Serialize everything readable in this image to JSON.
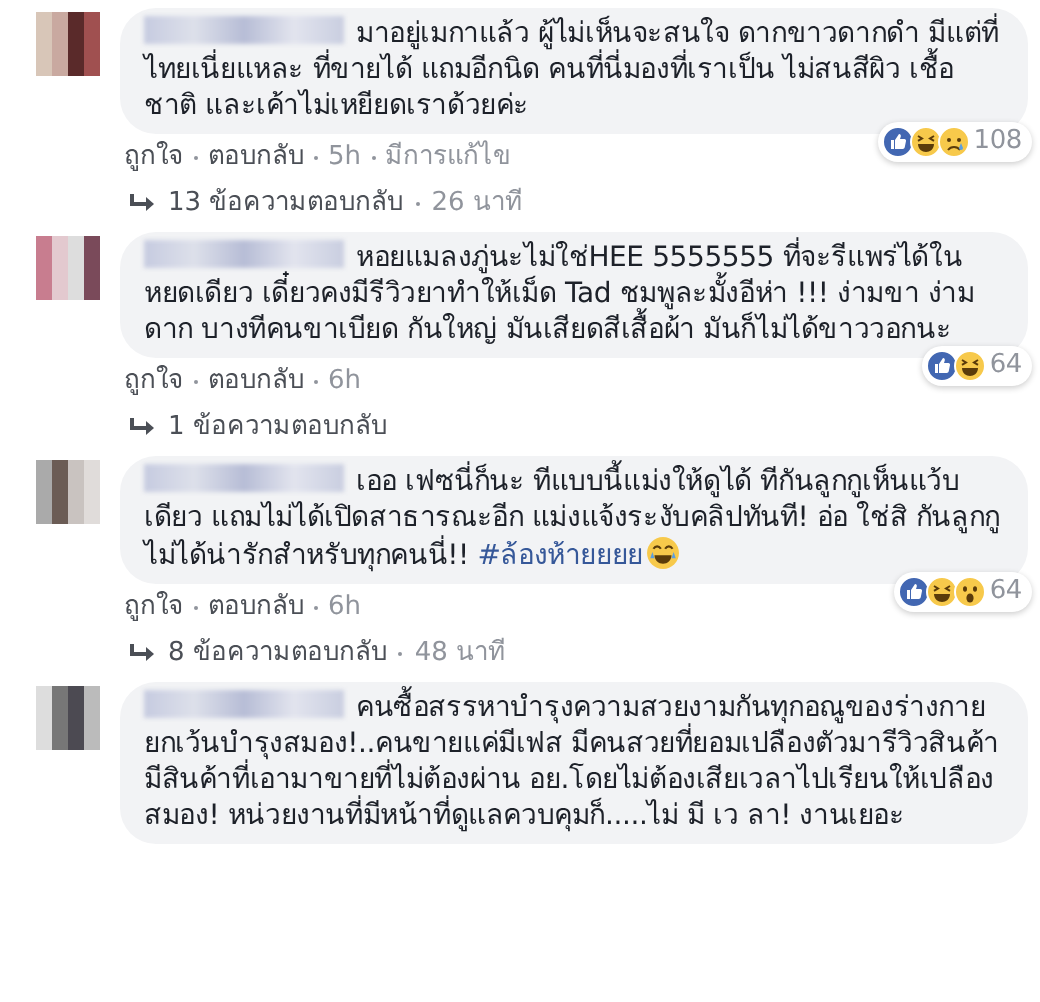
{
  "comments": [
    {
      "segments": [
        {
          "kind": "text",
          "text": "มาอยู่เมกาแล้ว ผู้ไม่เห็นจะสนใจ ดากขาวดากดำ มีแต่ที่ไทยเนี่ยแหละ ที่ขายได้ แถมอีกนิด คนที่นี่มองที่เราเป็น ไม่สนสีผิว เชื้อชาติ และเค้าไม่เหยียดเราด้วยค่ะ"
        }
      ],
      "reactions": [
        {
          "kind": "like"
        },
        {
          "kind": "haha"
        },
        {
          "kind": "sad"
        }
      ],
      "reaction_count": "108",
      "actions": [
        "ถูกใจ",
        "ตอบกลับ",
        "5h",
        "มีการแก้ไข"
      ],
      "replies": {
        "label": "13 ข้อความตอบกลับ",
        "time": "26 นาที"
      }
    },
    {
      "segments": [
        {
          "kind": "text",
          "text": "หอยแมลงภู่นะไม่ใช่HEE 5555555 ที่จะรีแพร่ได้ในหยดเดียว เดี๋ยวคงมีรีวิวยาทำให้เม็ด Tad ชมพูละมั้งอีห่า !!! ง่ามขา ง่ามดาก บางทีคนขาเบียด กันใหญ่ มันเสียดสีเสื้อผ้า มันก็ไม่ได้ขาววอกนะ"
        }
      ],
      "reactions": [
        {
          "kind": "like"
        },
        {
          "kind": "haha"
        }
      ],
      "reaction_count": "64",
      "actions": [
        "ถูกใจ",
        "ตอบกลับ",
        "6h"
      ],
      "replies": {
        "label": "1 ข้อความตอบกลับ"
      }
    },
    {
      "segments": [
        {
          "kind": "text",
          "text": "เออ เฟซนี่ก็นะ ทีแบบนี้แม่งให้ดูได้ ทีกันลูกกูเห็นแว้บเดียว แถมไม่ได้เปิดสาธารณะอีก แม่งแจ้งระงับคลิปทันที! อ่อ ใช่สิ กันลูกกูไม่ได้น่ารักสำหรับทุกคนนี่!! "
        },
        {
          "kind": "hashtag",
          "text": "#ล้องห้ายยยย"
        },
        {
          "kind": "emoji"
        }
      ],
      "reactions": [
        {
          "kind": "like"
        },
        {
          "kind": "haha"
        },
        {
          "kind": "wow"
        }
      ],
      "reaction_count": "64",
      "actions": [
        "ถูกใจ",
        "ตอบกลับ",
        "6h"
      ],
      "replies": {
        "label": "8 ข้อความตอบกลับ",
        "time": "48 นาที"
      }
    },
    {
      "segments": [
        {
          "kind": "text",
          "text": "คนซื้อสรรหาบำรุงความสวยงามกันทุกอณูของร่างกาย ยกเว้นบำรุงสมอง!..คนขายแค่มีเฟส มีคนสวยที่ยอมเปลืองตัวมารีวิวสินค้า มีสินค้าที่เอามาขายที่ไม่ต้องผ่าน อย.โดยไม่ต้องเสียเวลาไปเรียนให้เปลืองสมอง! หน่วยงานที่มีหน้าที่ดูแลควบคุมก็.....ไม่ มี เว ลา! งานเยอะ"
        }
      ]
    }
  ]
}
